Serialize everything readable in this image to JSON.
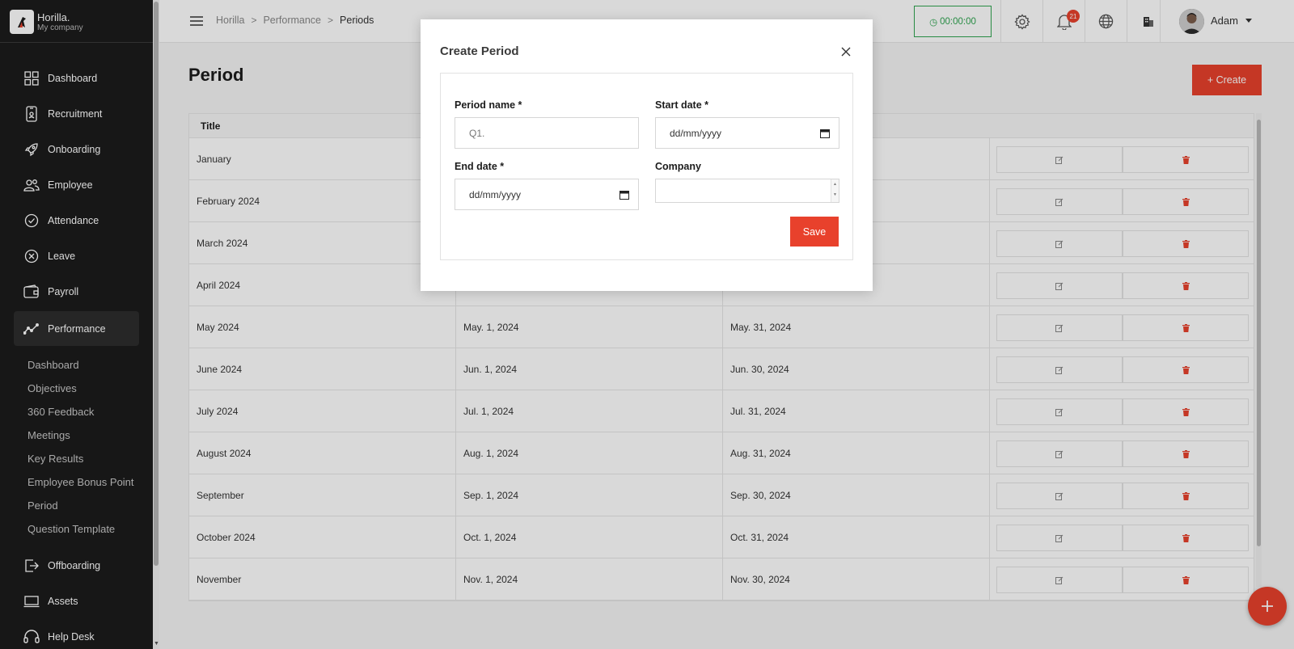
{
  "brand": {
    "name": "Horilla.",
    "company": "My company"
  },
  "sidebar": {
    "items": [
      {
        "label": "Dashboard",
        "icon": "dashboard-icon"
      },
      {
        "label": "Recruitment",
        "icon": "recruitment-icon"
      },
      {
        "label": "Onboarding",
        "icon": "rocket-icon"
      },
      {
        "label": "Employee",
        "icon": "people-icon"
      },
      {
        "label": "Attendance",
        "icon": "check-circle-icon"
      },
      {
        "label": "Leave",
        "icon": "x-circle-icon"
      },
      {
        "label": "Payroll",
        "icon": "wallet-icon"
      },
      {
        "label": "Performance",
        "icon": "trend-icon",
        "active": true
      },
      {
        "label": "Offboarding",
        "icon": "exit-icon"
      },
      {
        "label": "Assets",
        "icon": "laptop-icon"
      },
      {
        "label": "Help Desk",
        "icon": "headset-icon"
      }
    ],
    "performance_sub": [
      "Dashboard",
      "Objectives",
      "360 Feedback",
      "Meetings",
      "Key Results",
      "Employee Bonus Point",
      "Period",
      "Question Template"
    ]
  },
  "topbar": {
    "breadcrumb": [
      "Horilla",
      "Performance",
      "Periods"
    ],
    "timer": "00:00:00",
    "notifications": "21",
    "user": "Adam"
  },
  "page": {
    "title": "Period",
    "create_label": "+ Create"
  },
  "table": {
    "headers": [
      "Title"
    ],
    "rows": [
      {
        "title": "January",
        "start": "",
        "end": ""
      },
      {
        "title": "February 2024",
        "start": "",
        "end": ""
      },
      {
        "title": "March 2024",
        "start": "",
        "end": ""
      },
      {
        "title": "April 2024",
        "start": "",
        "end": ""
      },
      {
        "title": "May 2024",
        "start": "May. 1, 2024",
        "end": "May. 31, 2024"
      },
      {
        "title": "June 2024",
        "start": "Jun. 1, 2024",
        "end": "Jun. 30, 2024"
      },
      {
        "title": "July 2024",
        "start": "Jul. 1, 2024",
        "end": "Jul. 31, 2024"
      },
      {
        "title": "August 2024",
        "start": "Aug. 1, 2024",
        "end": "Aug. 31, 2024"
      },
      {
        "title": "September",
        "start": "Sep. 1, 2024",
        "end": "Sep. 30, 2024"
      },
      {
        "title": "October 2024",
        "start": "Oct. 1, 2024",
        "end": "Oct. 31, 2024"
      },
      {
        "title": "November",
        "start": "Nov. 1, 2024",
        "end": "Nov. 30, 2024"
      }
    ]
  },
  "modal": {
    "title": "Create Period",
    "period_name_label": "Period name *",
    "period_name_placeholder": "Q1.",
    "start_date_label": "Start date *",
    "start_date_value": "dd/mm/yyyy",
    "end_date_label": "End date *",
    "end_date_value": "dd/mm/yyyy",
    "company_label": "Company",
    "save_label": "Save"
  },
  "colors": {
    "accent": "#e8412c",
    "sidebar": "#1c1c1c",
    "timer": "#2ea44f"
  }
}
